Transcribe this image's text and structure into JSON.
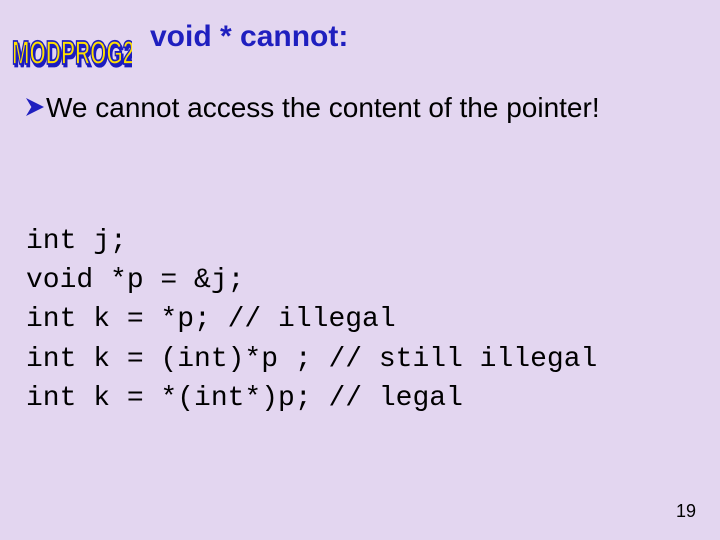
{
  "logo_text": "MODPROG2",
  "title": "void * cannot:",
  "bullet_text": "We cannot access the content of the pointer!",
  "code_lines": [
    "int j;",
    "void *p = &j;",
    "int k = *p; // illegal",
    "int k = (int)*p ; // still illegal",
    "int k = *(int*)p; // legal"
  ],
  "page_number": "19"
}
